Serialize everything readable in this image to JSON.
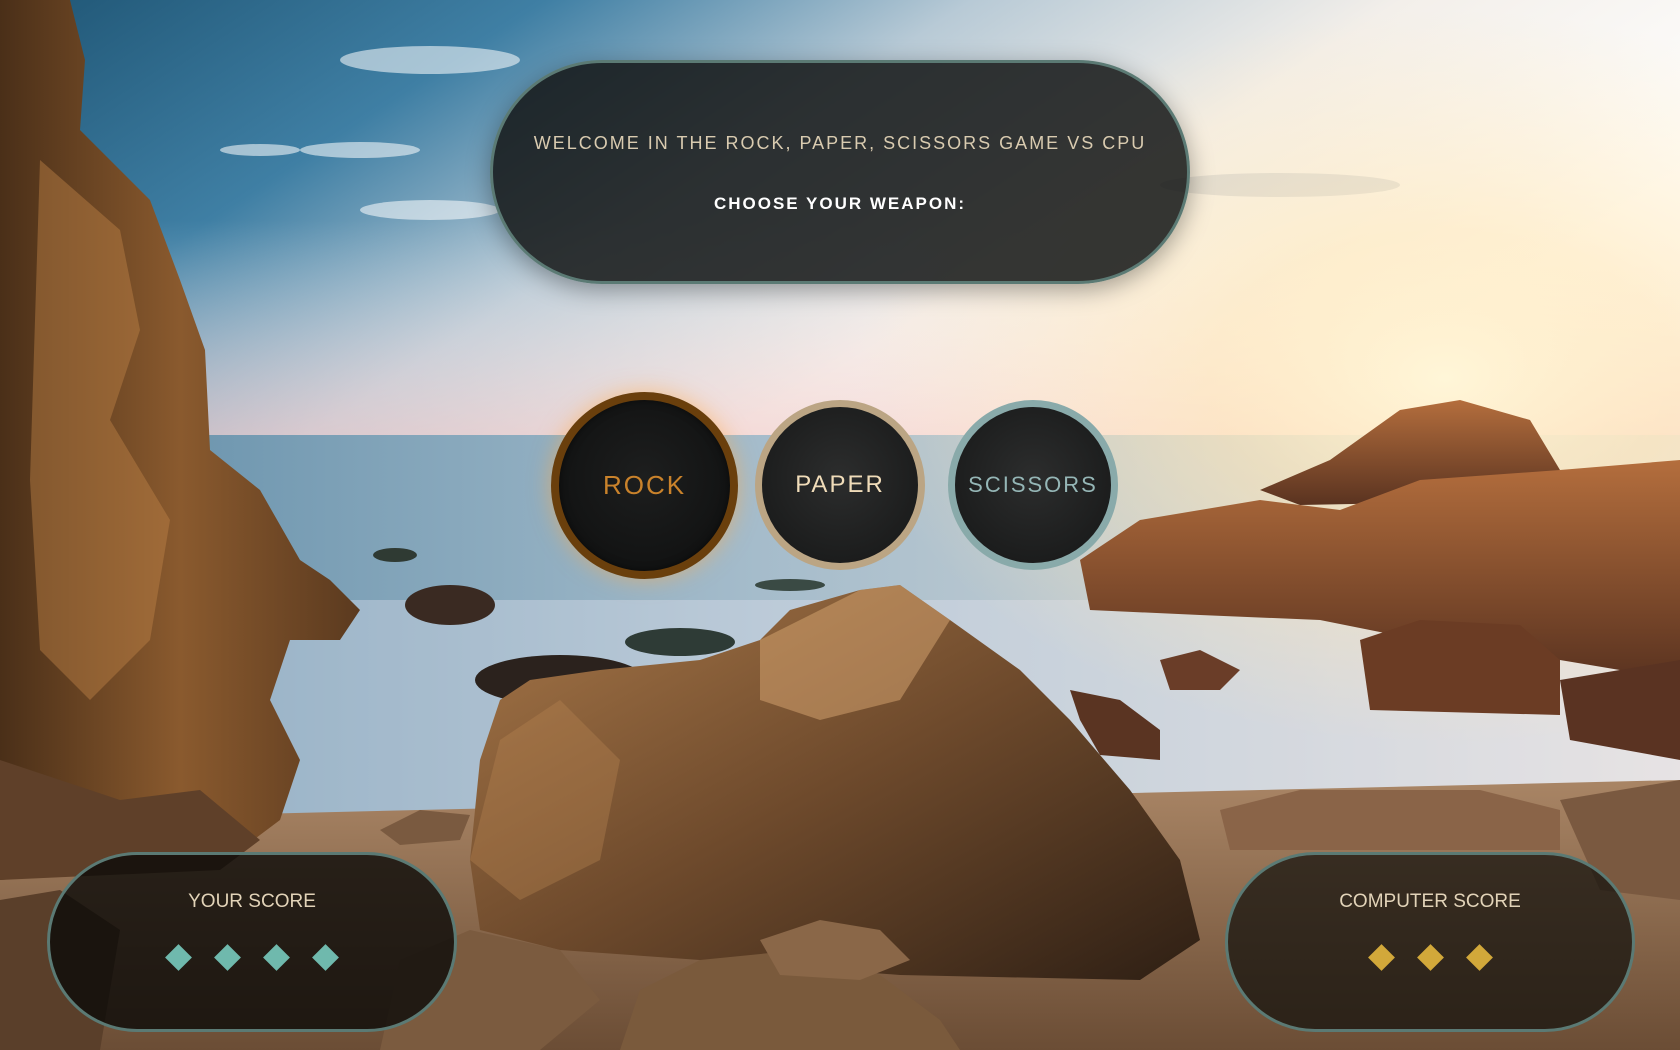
{
  "header": {
    "welcome": "WELCOME IN THE ROCK, PAPER, SCISSORS GAME VS CPU",
    "prompt": "CHOOSE YOUR WEAPON:"
  },
  "weapons": [
    {
      "label": "ROCK",
      "ring_color": "#6a3f0c",
      "text_color": "#c9822b",
      "highlighted": true
    },
    {
      "label": "PAPER",
      "ring_color": "#bba584",
      "text_color": "#f0dcb9",
      "highlighted": false
    },
    {
      "label": "SCISSORS",
      "ring_color": "#89aaaa",
      "text_color": "#95b6b6",
      "highlighted": false
    }
  ],
  "scores": {
    "player": {
      "title": "YOUR SCORE",
      "points": 4,
      "marker_color": "#6fb9ad",
      "marker_icon": "diamond-icon"
    },
    "computer": {
      "title": "COMPUTER SCORE",
      "points": 3,
      "marker_color": "#d2a83a",
      "marker_icon": "diamond-icon"
    }
  },
  "background": {
    "description_icon": "beach-rocks-sunset-scene"
  }
}
